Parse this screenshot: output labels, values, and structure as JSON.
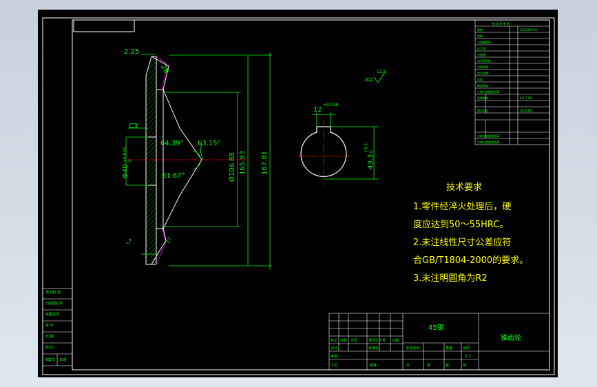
{
  "colors": {
    "background": "#000000",
    "frame": "#ffffff",
    "outline": "#ffffff",
    "dimension": "#00ff00",
    "hatch": "#00ff00",
    "centerline": "#ff0000",
    "notes": "#ffff00",
    "hidden": "#ff00ff"
  },
  "dimensions": {
    "chamfer_top": "2.25",
    "angle_tooth": "28",
    "chamfer_c": "C3",
    "bore_dia": "Φ40",
    "bore_tol_upper": "+0.025",
    "bore_tol_lower": "0",
    "angle_1": "64.39°",
    "angle_2": "63.15°",
    "angle_3": "61.67°",
    "dia_hub": "Ø106.88",
    "dia_mid": "165.93",
    "dia_outer": "167.81",
    "bottom_small": "5.4",
    "bottom_angle": "17",
    "keyway_width": "12",
    "keyway_tol": "+0.018",
    "keyway_depth": "43.3",
    "keyway_depth_tol_upper": "+0.1",
    "keyway_depth_tol_lower": "0",
    "roughness_value": "12.5",
    "roughness_label": "其余"
  },
  "tech_requirements": {
    "title": "技术要求",
    "lines": [
      "1.零件经淬火处理后，硬",
      "度应达到50～55HRC。",
      "2.未注线性尺寸公差应符",
      "合GB/T1804-2000的要求。",
      "3.未注明圆角为R2"
    ]
  },
  "title_block": {
    "material": "45钢",
    "part_name": "锥齿轮",
    "scale": "1:1"
  }
}
